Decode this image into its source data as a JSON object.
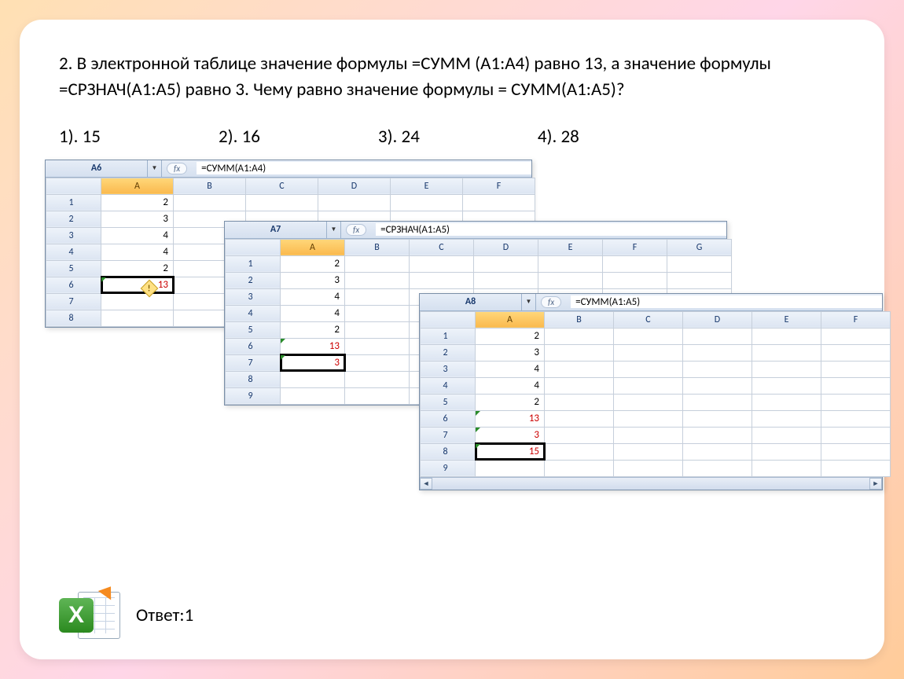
{
  "question": "2. В электронной таблице значение формулы  =СУММ (A1:A4) равно 13, а значение формулы =СРЗНАЧ(A1:A5) равно 3. Чему равно значение формулы = СУММ(A1:A5)?",
  "options": {
    "o1": "1). 15",
    "o2": "2). 16",
    "o3": "3). 24",
    "o4": "4). 28"
  },
  "answer": "Ответ:1",
  "win1": {
    "cellRef": "A6",
    "formula": "=СУММ(A1:A4)",
    "cols": [
      "A",
      "B",
      "C",
      "D",
      "E",
      "F"
    ],
    "rows": [
      {
        "n": "1",
        "a": "2"
      },
      {
        "n": "2",
        "a": "3"
      },
      {
        "n": "3",
        "a": "4"
      },
      {
        "n": "4",
        "a": "4"
      },
      {
        "n": "5",
        "a": "2"
      },
      {
        "n": "6",
        "a": "13",
        "sel": true,
        "red": true,
        "tri": true
      },
      {
        "n": "7",
        "a": ""
      },
      {
        "n": "8",
        "a": ""
      }
    ]
  },
  "win2": {
    "cellRef": "A7",
    "formula": "=СРЗНАЧ(A1:A5)",
    "cols": [
      "A",
      "B",
      "C",
      "D",
      "E",
      "F",
      "G"
    ],
    "rows": [
      {
        "n": "1",
        "a": "2"
      },
      {
        "n": "2",
        "a": "3"
      },
      {
        "n": "3",
        "a": "4"
      },
      {
        "n": "4",
        "a": "4"
      },
      {
        "n": "5",
        "a": "2"
      },
      {
        "n": "6",
        "a": "13",
        "red": true,
        "tri": true
      },
      {
        "n": "7",
        "a": "3",
        "sel": true,
        "red": true,
        "tri": true
      },
      {
        "n": "8",
        "a": ""
      },
      {
        "n": "9",
        "a": ""
      }
    ]
  },
  "win3": {
    "cellRef": "A8",
    "formula": "=СУММ(A1:A5)",
    "cols": [
      "A",
      "B",
      "C",
      "D",
      "E",
      "F"
    ],
    "rows": [
      {
        "n": "1",
        "a": "2"
      },
      {
        "n": "2",
        "a": "3"
      },
      {
        "n": "3",
        "a": "4"
      },
      {
        "n": "4",
        "a": "4"
      },
      {
        "n": "5",
        "a": "2"
      },
      {
        "n": "6",
        "a": "13",
        "red": true,
        "tri": true
      },
      {
        "n": "7",
        "a": "3",
        "red": true,
        "tri": true
      },
      {
        "n": "8",
        "a": "15",
        "sel": true,
        "red": true,
        "tri": true
      },
      {
        "n": "9",
        "a": ""
      }
    ]
  }
}
